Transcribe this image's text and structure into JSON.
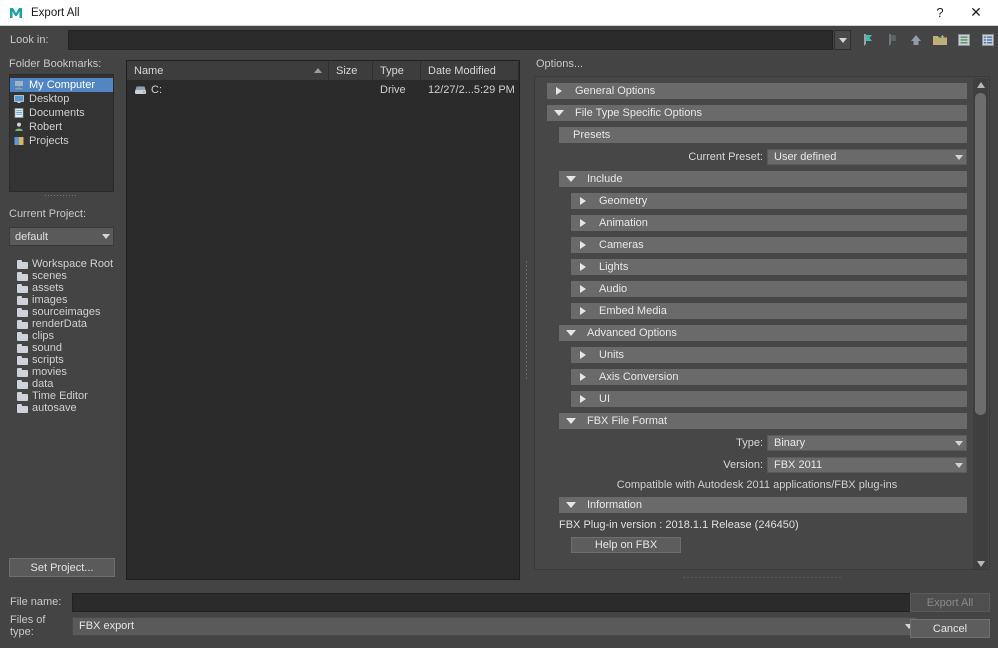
{
  "window": {
    "title": "Export All",
    "logo_icon": "maya-m-logo-icon",
    "help_label": "?",
    "close_label": "✕"
  },
  "lookin": {
    "label": "Look in:",
    "value": "",
    "dropdown_icon": "chevron-down-icon",
    "toolbar_icons": [
      {
        "name": "back-bookmark-icon"
      },
      {
        "name": "forward-icon"
      },
      {
        "name": "parent-directory-icon"
      },
      {
        "name": "new-folder-icon"
      },
      {
        "name": "list-view-icon"
      },
      {
        "name": "detail-view-icon"
      }
    ]
  },
  "bookmarks": {
    "label": "Folder Bookmarks:",
    "items": [
      {
        "label": "My Computer",
        "icon": "computer-icon",
        "selected": true
      },
      {
        "label": "Desktop",
        "icon": "desktop-icon",
        "selected": false
      },
      {
        "label": "Documents",
        "icon": "documents-icon",
        "selected": false
      },
      {
        "label": "Robert",
        "icon": "user-folder-icon",
        "selected": false
      },
      {
        "label": "Projects",
        "icon": "projects-icon",
        "selected": false
      }
    ]
  },
  "current_project": {
    "label": "Current Project:",
    "value": "default",
    "dropdown_icon": "chevron-down-icon"
  },
  "workspace_folders": [
    {
      "label": "Workspace Root"
    },
    {
      "label": "scenes"
    },
    {
      "label": "assets"
    },
    {
      "label": "images"
    },
    {
      "label": "sourceimages"
    },
    {
      "label": "renderData"
    },
    {
      "label": "clips"
    },
    {
      "label": "sound"
    },
    {
      "label": "scripts"
    },
    {
      "label": "movies"
    },
    {
      "label": "data"
    },
    {
      "label": "Time Editor"
    },
    {
      "label": "autosave"
    }
  ],
  "set_project_button": "Set Project...",
  "file_list": {
    "columns": [
      {
        "label": "Name",
        "sorted": "asc"
      },
      {
        "label": "Size",
        "sorted": ""
      },
      {
        "label": "Type",
        "sorted": ""
      },
      {
        "label": "Date Modified",
        "sorted": ""
      }
    ],
    "rows": [
      {
        "name": "C:",
        "icon": "drive-icon",
        "size": "",
        "type": "Drive",
        "date_modified": "12/27/2...5:29 PM"
      }
    ]
  },
  "options": {
    "title": "Options...",
    "sections": [
      {
        "label": "General Options",
        "level": 0,
        "expanded": false
      },
      {
        "label": "File Type Specific Options",
        "level": 0,
        "expanded": true
      },
      {
        "label": "Presets",
        "level": 1,
        "plain": true
      },
      {
        "label": "Include",
        "level": 1,
        "expanded": true
      },
      {
        "label": "Geometry",
        "level": 2,
        "expanded": false
      },
      {
        "label": "Animation",
        "level": 2,
        "expanded": false
      },
      {
        "label": "Cameras",
        "level": 2,
        "expanded": false
      },
      {
        "label": "Lights",
        "level": 2,
        "expanded": false
      },
      {
        "label": "Audio",
        "level": 2,
        "expanded": false
      },
      {
        "label": "Embed Media",
        "level": 2,
        "expanded": false
      },
      {
        "label": "Advanced Options",
        "level": 1,
        "expanded": true
      },
      {
        "label": "Units",
        "level": 2,
        "expanded": false
      },
      {
        "label": "Axis Conversion",
        "level": 2,
        "expanded": false
      },
      {
        "label": "UI",
        "level": 2,
        "expanded": false
      },
      {
        "label": "FBX File Format",
        "level": 1,
        "expanded": true
      },
      {
        "label": "Information",
        "level": 1,
        "expanded": true
      }
    ],
    "current_preset": {
      "label": "Current Preset:",
      "value": "User defined"
    },
    "fbx_type": {
      "label": "Type:",
      "value": "Binary"
    },
    "fbx_version": {
      "label": "Version:",
      "value": "FBX 2011"
    },
    "compat_note": "Compatible with Autodesk 2011 applications/FBX plug-ins",
    "plugin_version": "FBX Plug-in version :  2018.1.1 Release (246450)",
    "help_button": "Help on FBX",
    "scrollbar": {
      "up_icon": "scroll-up-icon",
      "down_icon": "scroll-down-icon"
    }
  },
  "footer": {
    "file_name_label": "File name:",
    "file_name_value": "",
    "file_name_placeholder": "",
    "files_of_type_label": "Files of type:",
    "files_of_type_value": "FBX export",
    "export_button": "Export All",
    "cancel_button": "Cancel"
  },
  "colors": {
    "window_bg": "#444444",
    "panel_bg": "#474747",
    "bar_bg": "#6a6a6a",
    "selection_blue": "#5285c4",
    "dark_field": "#2b2b2b",
    "title_bar": "#ffffff"
  }
}
